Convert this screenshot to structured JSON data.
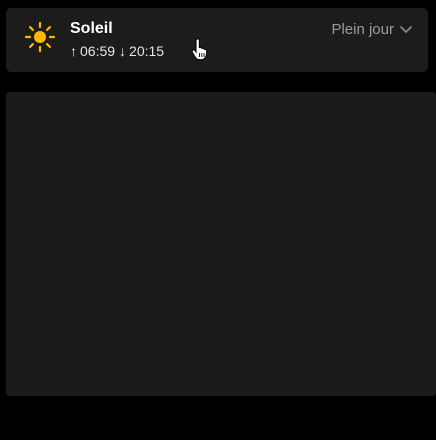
{
  "sun_widget": {
    "icon": "sun-icon",
    "title": "Soleil",
    "sunrise_arrow": "↑",
    "sunrise": "06:59",
    "sunset_arrow": "↓",
    "sunset": "20:15",
    "mode": "Plein jour",
    "mode_icon": "chevron-down-icon"
  },
  "colors": {
    "sun": "#FFB800",
    "card_bg": "#1c1c1c",
    "page_bg": "#000000"
  }
}
